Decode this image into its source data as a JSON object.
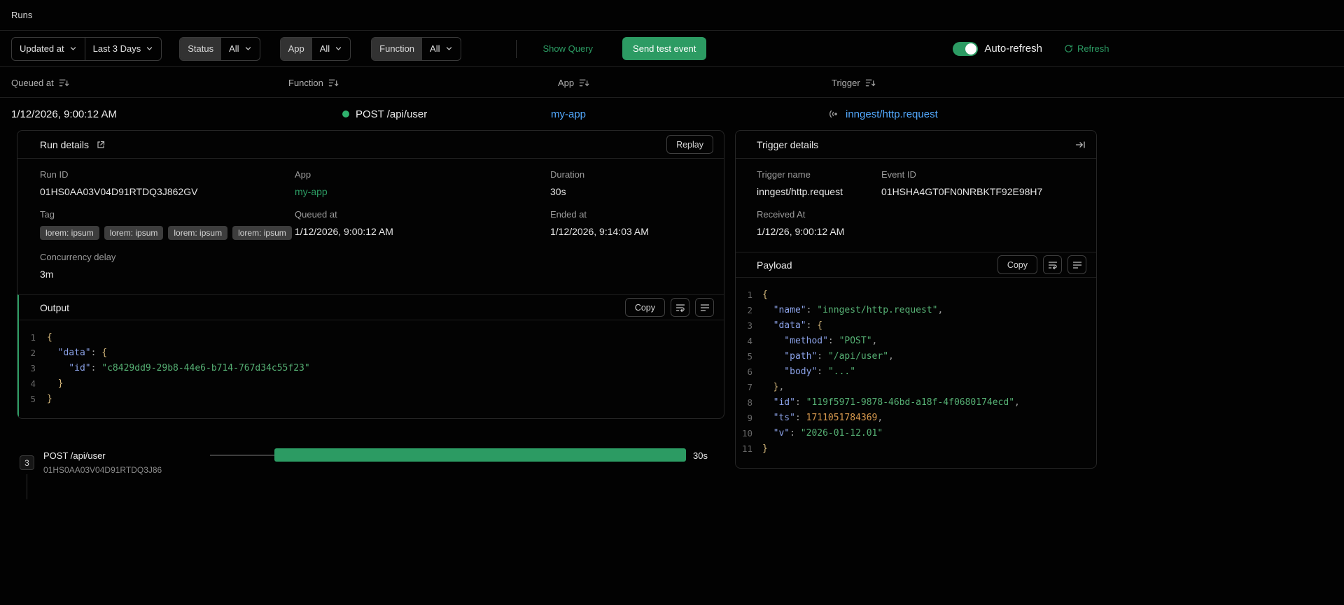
{
  "colors": {
    "accent": "#2c9b63",
    "link": "#52a8fd",
    "code-key": "#8ba2e8",
    "code-str": "#56b074",
    "code-num": "#d99a4e",
    "code-brace": "#d7ba7d"
  },
  "page": {
    "title": "Runs"
  },
  "filter_bar": {
    "sort_field": {
      "label": "Updated at"
    },
    "time_range": {
      "label": "Last 3 Days"
    },
    "status": {
      "label": "Status",
      "value": "All"
    },
    "app": {
      "label": "App",
      "value": "All"
    },
    "function": {
      "label": "Function",
      "value": "All"
    },
    "show_query_label": "Show Query",
    "send_test_event_label": "Send test event",
    "auto_refresh_label": "Auto-refresh",
    "refresh_label": "Refresh"
  },
  "runs_table": {
    "columns": {
      "queued_at": "Queued at",
      "function": "Function",
      "app": "App",
      "trigger": "Trigger"
    },
    "row": {
      "queued_at": "1/12/2026, 9:00:12 AM",
      "function_name": "POST /api/user",
      "app": "my-app",
      "trigger": "inngest/http.request"
    }
  },
  "run_details": {
    "title": "Run details",
    "replay_label": "Replay",
    "run_id": {
      "label": "Run ID",
      "value": "01HS0AA03V04D91RTDQ3J862GV"
    },
    "app": {
      "label": "App",
      "value": "my-app"
    },
    "duration": {
      "label": "Duration",
      "value": "30s"
    },
    "tag": {
      "label": "Tag",
      "tags": [
        "lorem: ipsum",
        "lorem: ipsum",
        "lorem: ipsum",
        "lorem: ipsum"
      ]
    },
    "queued_at": {
      "label": "Queued at",
      "value": "1/12/2026, 9:00:12 AM"
    },
    "ended_at": {
      "label": "Ended at",
      "value": "1/12/2026, 9:14:03 AM"
    },
    "concurrency_delay": {
      "label": "Concurrency delay",
      "value": "3m"
    },
    "output": {
      "title": "Output",
      "copy_label": "Copy",
      "code": [
        [
          {
            "c": "b",
            "t": "{"
          }
        ],
        [
          {
            "c": "k",
            "t": "  \"data\""
          },
          {
            "c": "p",
            "t": ": "
          },
          {
            "c": "b",
            "t": "{"
          }
        ],
        [
          {
            "c": "k",
            "t": "    \"id\""
          },
          {
            "c": "p",
            "t": ": "
          },
          {
            "c": "s",
            "t": "\"c8429dd9-29b8-44e6-b714-767d34c55f23\""
          }
        ],
        [
          {
            "c": "b",
            "t": "  }"
          }
        ],
        [
          {
            "c": "b",
            "t": "}"
          }
        ]
      ]
    }
  },
  "trigger_details": {
    "title": "Trigger details",
    "trigger_name": {
      "label": "Trigger name",
      "value": "inngest/http.request"
    },
    "event_id": {
      "label": "Event ID",
      "value": "01HSHA4GT0FN0NRBKTF92E98H7"
    },
    "received_at": {
      "label": "Received At",
      "value": "1/12/26, 9:00:12 AM"
    },
    "payload": {
      "title": "Payload",
      "copy_label": "Copy",
      "code": [
        [
          {
            "c": "b",
            "t": "{"
          }
        ],
        [
          {
            "c": "k",
            "t": "  \"name\""
          },
          {
            "c": "p",
            "t": ": "
          },
          {
            "c": "s",
            "t": "\"inngest/http.request\""
          },
          {
            "c": "p",
            "t": ","
          }
        ],
        [
          {
            "c": "k",
            "t": "  \"data\""
          },
          {
            "c": "p",
            "t": ": "
          },
          {
            "c": "b",
            "t": "{"
          }
        ],
        [
          {
            "c": "k",
            "t": "    \"method\""
          },
          {
            "c": "p",
            "t": ": "
          },
          {
            "c": "s",
            "t": "\"POST\""
          },
          {
            "c": "p",
            "t": ","
          }
        ],
        [
          {
            "c": "k",
            "t": "    \"path\""
          },
          {
            "c": "p",
            "t": ": "
          },
          {
            "c": "s",
            "t": "\"/api/user\""
          },
          {
            "c": "p",
            "t": ","
          }
        ],
        [
          {
            "c": "k",
            "t": "    \"body\""
          },
          {
            "c": "p",
            "t": ": "
          },
          {
            "c": "s",
            "t": "\"...\""
          }
        ],
        [
          {
            "c": "b",
            "t": "  }"
          },
          {
            "c": "p",
            "t": ","
          }
        ],
        [
          {
            "c": "k",
            "t": "  \"id\""
          },
          {
            "c": "p",
            "t": ": "
          },
          {
            "c": "s",
            "t": "\"119f5971-9878-46bd-a18f-4f0680174ecd\""
          },
          {
            "c": "p",
            "t": ","
          }
        ],
        [
          {
            "c": "k",
            "t": "  \"ts\""
          },
          {
            "c": "p",
            "t": ": "
          },
          {
            "c": "n",
            "t": "1711051784369"
          },
          {
            "c": "p",
            "t": ","
          }
        ],
        [
          {
            "c": "k",
            "t": "  \"v\""
          },
          {
            "c": "p",
            "t": ": "
          },
          {
            "c": "s",
            "t": "\"2026-01-12.01\""
          }
        ],
        [
          {
            "c": "b",
            "t": "}"
          }
        ]
      ]
    }
  },
  "trace": {
    "step_count": "3",
    "function_name": "POST /api/user",
    "run_id": "01HS0AA03V04D91RTDQ3J86",
    "duration": "30s"
  }
}
